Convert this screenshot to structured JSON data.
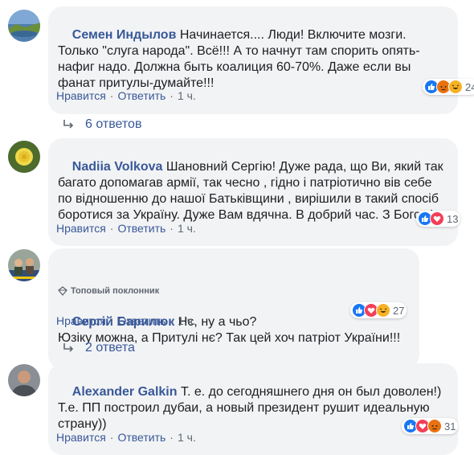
{
  "comments": [
    {
      "author": "Семен Индылов",
      "text": "Начинается.... Люди! Включите мозги. Только \"слуга народа\". Всё!!! А то начнут там спорить опять-нафиг надо. Должна быть коалиция 60-70%. Даже если вы фанат притулы-думайте!!!",
      "reaction_count": "24",
      "reactions": [
        "like",
        "angry",
        "haha"
      ],
      "like_label": "Нравится",
      "reply_label": "Ответить",
      "time": "1 ч."
    },
    {
      "author": "Nadiia Volkova",
      "text": "Шановний Сергію! Дуже рада, що Ви, який так багато допомагав армії, так чесно , гідно і патріотично вів себе по відношенню до нашої Батьківщини , вирішили в такий спосіб боротися за Україну. Дуже Вам вдячна. В добрий час. З Богом!",
      "reaction_count": "13",
      "reactions": [
        "like",
        "love"
      ],
      "like_label": "Нравится",
      "reply_label": "Ответить",
      "time": "1 ч."
    },
    {
      "badge": "Топовый поклонник",
      "author": "Сергій Барилюк",
      "text": "Нє, ну а чьо?\nЮзіку можна, а Притулі нє? Так цей хоч патріот України!!!",
      "reaction_count": "27",
      "reactions": [
        "like",
        "love",
        "haha"
      ],
      "like_label": "Нравится",
      "reply_label": "Ответить",
      "time": "1 ч."
    },
    {
      "author": "Alexander Galkin",
      "text": "Т. е. до сегодняшнего дня он был доволен!)\nТ.е. ПП построил дубаи, а новый президент рушит идеальную страну))",
      "reaction_count": "31",
      "reactions": [
        "like",
        "love",
        "angry"
      ],
      "like_label": "Нравится",
      "reply_label": "Ответить",
      "time": "1 ч."
    }
  ],
  "reply_threads": [
    {
      "label": "6 ответов"
    },
    {
      "label": "2 ответа"
    }
  ],
  "colors": {
    "author": "#385898",
    "bubble": "#f2f3f5",
    "meta": "#606770",
    "like": "#1877f2",
    "love": "#f33e58",
    "angry": "#e9710f",
    "haha": "#f7b125"
  }
}
